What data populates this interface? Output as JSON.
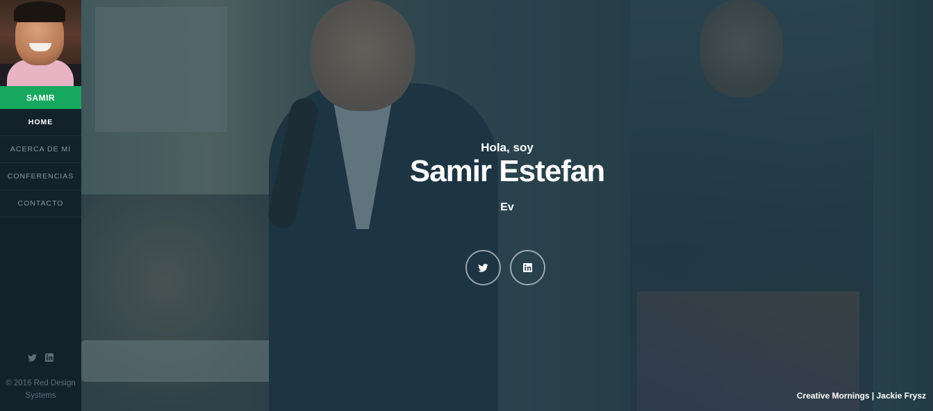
{
  "sidebar": {
    "brand": "SAMIR",
    "nav": [
      {
        "label": "HOME",
        "active": true
      },
      {
        "label": "ACERCA DE MÍ",
        "active": false
      },
      {
        "label": "CONFERENCIAS",
        "active": false
      },
      {
        "label": "CONTACTO",
        "active": false
      }
    ],
    "social_icons": [
      "twitter-icon",
      "linkedin-icon"
    ],
    "copyright": "© 2016 Red Design Systems"
  },
  "hero": {
    "greeting": "Hola, soy",
    "name": "Samir Estefan",
    "tagline": "Ev",
    "social_icons": [
      "twitter-icon",
      "linkedin-icon"
    ],
    "photo_credit": "Creative Mornings | Jackie Frysz"
  },
  "colors": {
    "sidebar_bg": "#13212b",
    "brand_green": "#16a85e",
    "overlay": "#2f4a54",
    "text": "#ffffff"
  }
}
